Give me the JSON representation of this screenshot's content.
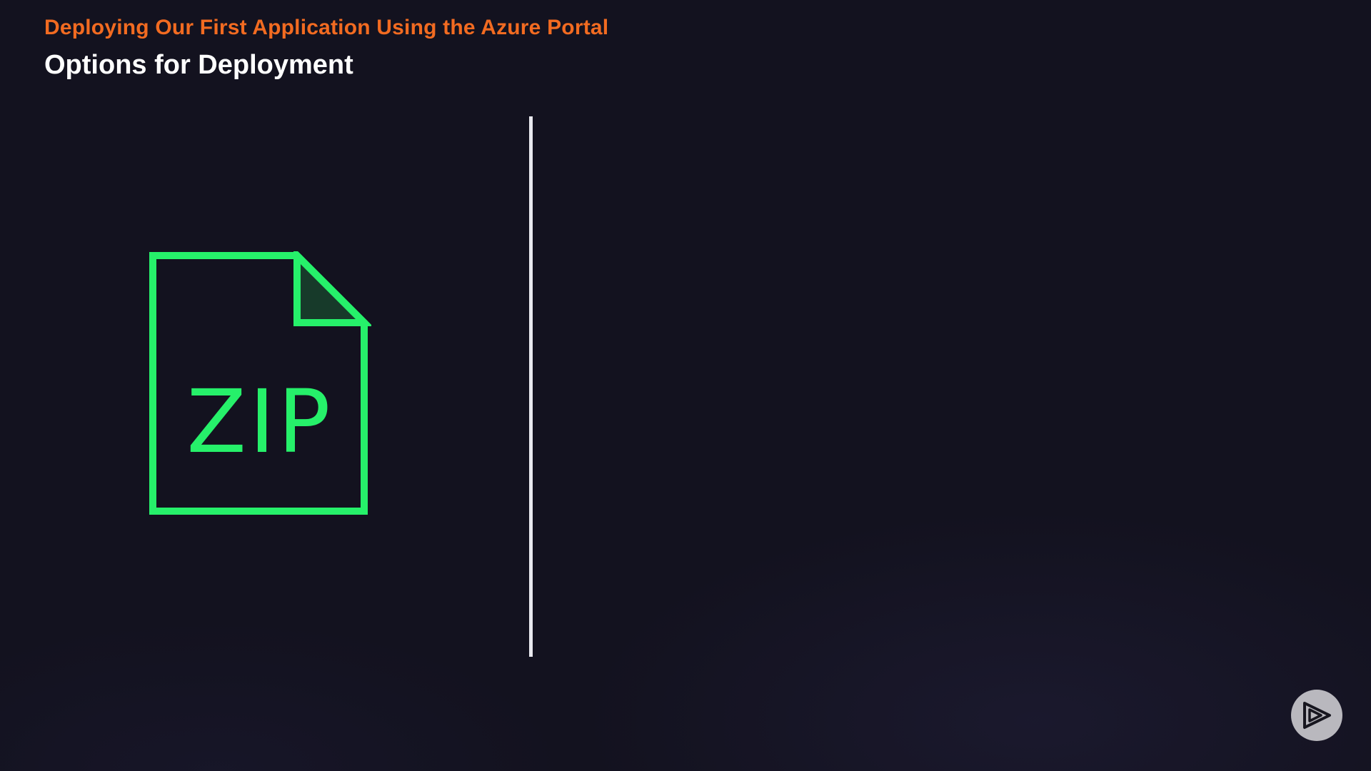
{
  "header": {
    "kicker": "Deploying Our First Application Using the Azure Portal",
    "title": "Options for Deployment"
  },
  "content": {
    "zip_icon": {
      "label": "ZIP",
      "icon": "zip-file-icon"
    }
  },
  "player": {
    "logo_icon": "play-logo-icon"
  },
  "colors": {
    "background": "#13121f",
    "accent_orange": "#f26b21",
    "title_white": "#ffffff",
    "icon_green": "#26f06a",
    "divider": "#e8e8ee"
  }
}
